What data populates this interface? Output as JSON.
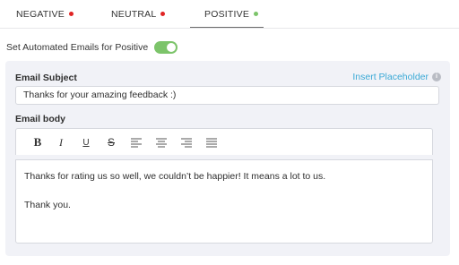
{
  "tabs": [
    {
      "label": "NEGATIVE",
      "dot_color": "#e02424"
    },
    {
      "label": "NEUTRAL",
      "dot_color": "#e02424"
    },
    {
      "label": "POSITIVE",
      "dot_color": "#7cc46a",
      "active": true
    }
  ],
  "toggle": {
    "label": "Set Automated Emails for Positive",
    "on": true,
    "color": "#7cc46a"
  },
  "email_subject": {
    "label": "Email Subject",
    "insert_placeholder": "Insert Placeholder",
    "value": "Thanks for your amazing feedback :)"
  },
  "email_body": {
    "label": "Email body",
    "toolbar": {
      "bold": "B",
      "italic": "I",
      "underline": "U",
      "strikethrough": "S",
      "icons": [
        "bold-icon",
        "italic-icon",
        "underline-icon",
        "strikethrough-icon",
        "align-left-icon",
        "align-center-icon",
        "align-right-icon",
        "align-justify-icon"
      ]
    },
    "paragraphs": [
      "Thanks for rating us so well, we couldn’t be happier! It means a lot to us.",
      "Thank you."
    ]
  },
  "colors": {
    "link": "#3aa9d6",
    "panel_bg": "#f1f2f7",
    "toggle_on": "#7cc46a",
    "dot_red": "#e02424",
    "dot_green": "#7cc46a"
  }
}
